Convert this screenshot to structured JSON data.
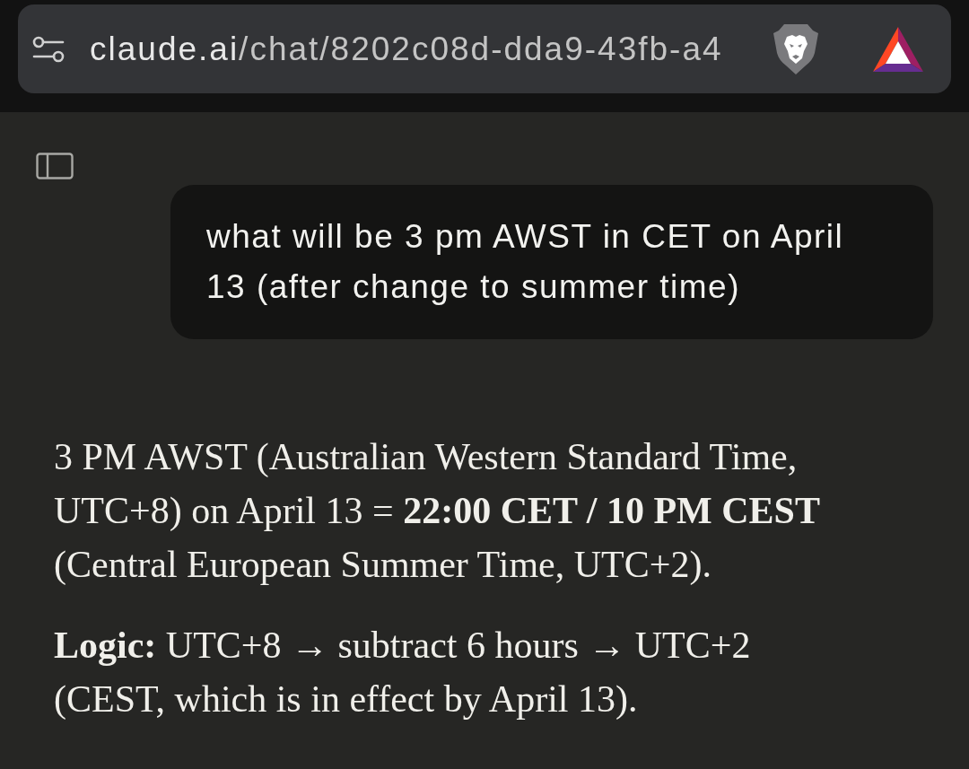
{
  "address_bar": {
    "domain": "claude.ai",
    "path": "/chat/8202c08d-dda9-43fb-a4"
  },
  "conversation": {
    "user_message": "what will be 3 pm AWST in CET on April 13 (after change to summer time)",
    "response": {
      "paragraphs": [
        "3 PM AWST (Australian Western Standard Time, UTC+8) on April 13 = **22:00 CET / 10 PM CEST** (Central European Summer Time, UTC+2).",
        "**Logic:** UTC+8 → subtract 6 hours → UTC+2 (CEST, which is in effect by April 13)."
      ]
    }
  }
}
